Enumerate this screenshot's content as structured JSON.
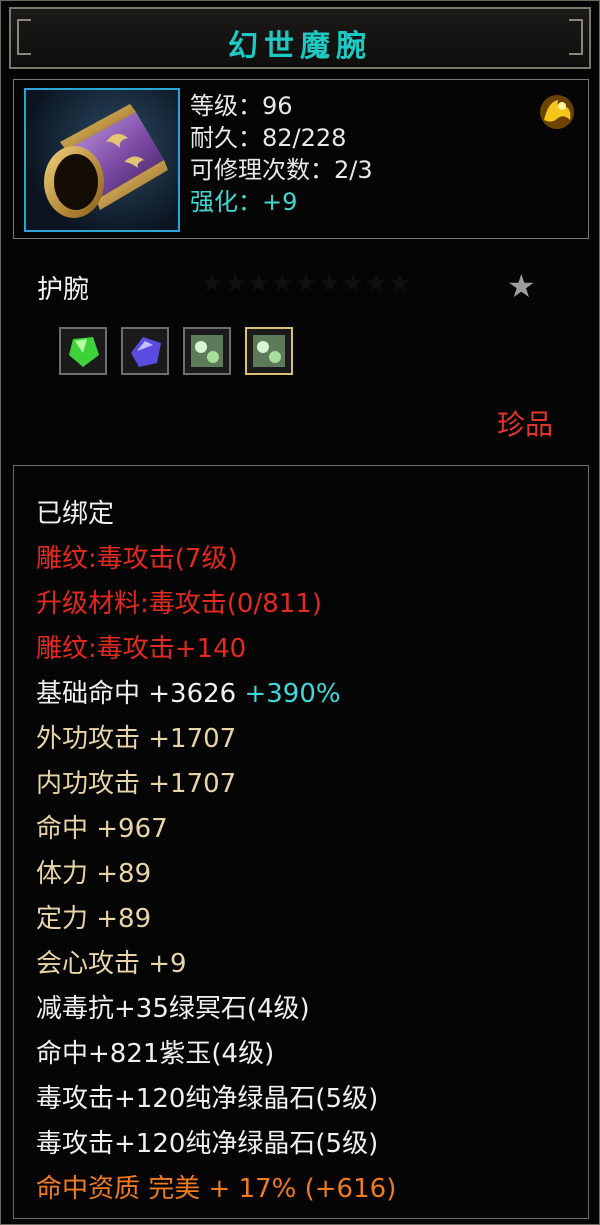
{
  "title": "幻世魔腕",
  "stats": {
    "level": "等级：96",
    "durability": "耐久：82/228",
    "repair": "可修理次数：2/3",
    "enhance": "强化：+9"
  },
  "item_type": "护腕",
  "stars": "★★★★★★★★★",
  "rarity": "珍品",
  "gem_icons": [
    "green-gem-icon",
    "purple-gem-icon",
    "green-crystal-icon",
    "green-crystal-icon"
  ],
  "attributes": {
    "bound": "已绑定",
    "engrave1": "雕纹:毒攻击(7级)",
    "upgrade": "升级材料:毒攻击(0/811)",
    "engrave2": "雕纹:毒攻击+140",
    "base_hit_label": "基础命中  +3626 ",
    "base_hit_bonus": "+390%",
    "ext_attack": "外功攻击  +1707",
    "int_attack": "内功攻击  +1707",
    "hit": "命中  +967",
    "stamina": "体力  +89",
    "focus": "定力  +89",
    "crit": "会心攻击  +9",
    "gem1": "减毒抗+35绿冥石(4级)",
    "gem2": "命中+821紫玉(4级)",
    "gem3": "毒攻击+120纯净绿晶石(5级)",
    "gem4": "毒攻击+120纯净绿晶石(5级)",
    "quality": "命中资质  完美  + 17% (+616)"
  },
  "colors": {
    "title": "#1ec9c4",
    "enhance": "#42d7d1",
    "red": "#e12a22",
    "gold": "#e7d4a8",
    "orange": "#ef7b22"
  }
}
